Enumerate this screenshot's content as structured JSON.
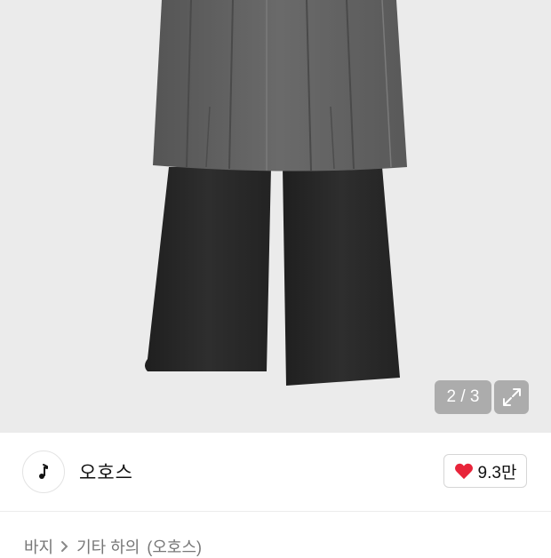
{
  "gallery": {
    "page_indicator": "2 / 3",
    "image_alt": "product-photo-layered-skirt-pants",
    "colors": {
      "background": "#eaeaea",
      "skirt": "#5f5f5f",
      "pants": "#2b2b2b"
    }
  },
  "store": {
    "name": "오호스",
    "logo_icon": "music-note-icon"
  },
  "like": {
    "icon": "heart-icon",
    "count": "9.3만",
    "color": "#e8243a"
  },
  "breadcrumb": {
    "items": [
      "바지",
      "기타 하의",
      "(오호스)"
    ],
    "separator_icon": "chevron-right-icon"
  }
}
